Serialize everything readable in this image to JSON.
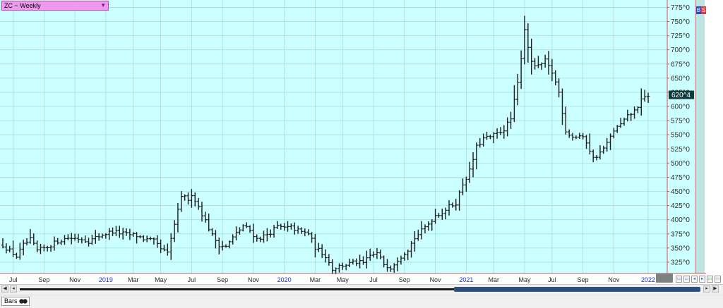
{
  "header": {
    "symbol_label": "ZC ~ Weekly",
    "dropdown_arrow": "▼",
    "side_buttons": [
      "B",
      "S"
    ]
  },
  "bottom_tabs": {
    "bars_label": "Bars",
    "bars_icon": "toggle-icon"
  },
  "scrollbar": {
    "left_btn": "◀",
    "left_btn2": "◂",
    "right_btn": "▸",
    "right_btn2": "▶"
  },
  "colors": {
    "plot_bg": "#ccffff",
    "grid": "#a3dede",
    "bars": "#1a1a1a",
    "axis_border": "#e05050",
    "year_label": "#1530c8",
    "month_label": "#2a2a2a",
    "price_label": "#333333",
    "last_price_bg": "#0e3a3a"
  },
  "chart_data": {
    "type": "ohlc",
    "title": "ZC ~ Weekly",
    "y_axis": {
      "range": [
        305,
        788
      ],
      "ticks": [
        {
          "value": 325,
          "label": "325^0"
        },
        {
          "value": 350,
          "label": "350^0"
        },
        {
          "value": 375,
          "label": "375^0"
        },
        {
          "value": 400,
          "label": "400^0"
        },
        {
          "value": 425,
          "label": "425^0"
        },
        {
          "value": 450,
          "label": "450^0"
        },
        {
          "value": 475,
          "label": "475^0"
        },
        {
          "value": 500,
          "label": "500^0"
        },
        {
          "value": 525,
          "label": "525^0"
        },
        {
          "value": 550,
          "label": "550^0"
        },
        {
          "value": 575,
          "label": "575^0"
        },
        {
          "value": 600,
          "label": "600^0"
        },
        {
          "value": 625,
          "label": "625^0"
        },
        {
          "value": 650,
          "label": "650^0"
        },
        {
          "value": 675,
          "label": "675^0"
        },
        {
          "value": 700,
          "label": "700^0"
        },
        {
          "value": 725,
          "label": "725^0"
        },
        {
          "value": 750,
          "label": "750^0"
        },
        {
          "value": 775,
          "label": "775^0"
        }
      ],
      "last_price": {
        "value": 620.5,
        "label": "620^4"
      }
    },
    "x_axis": {
      "range_weeks": [
        0,
        188
      ],
      "ticks": [
        {
          "label": "Jul",
          "week": 3,
          "year": false
        },
        {
          "label": "Sep",
          "week": 12,
          "year": false
        },
        {
          "label": "Nov",
          "week": 21,
          "year": false
        },
        {
          "label": "2019",
          "week": 30,
          "year": true
        },
        {
          "label": "Mar",
          "week": 38,
          "year": false
        },
        {
          "label": "May",
          "week": 46,
          "year": false
        },
        {
          "label": "Jul",
          "week": 55,
          "year": false
        },
        {
          "label": "Sep",
          "week": 64,
          "year": false
        },
        {
          "label": "Nov",
          "week": 73,
          "year": false
        },
        {
          "label": "2020",
          "week": 82,
          "year": true
        },
        {
          "label": "Mar",
          "week": 91,
          "year": false
        },
        {
          "label": "May",
          "week": 99,
          "year": false
        },
        {
          "label": "Jul",
          "week": 108,
          "year": false
        },
        {
          "label": "Sep",
          "week": 117,
          "year": false
        },
        {
          "label": "Nov",
          "week": 126,
          "year": false
        },
        {
          "label": "2021",
          "week": 135,
          "year": true
        },
        {
          "label": "Mar",
          "week": 143,
          "year": false
        },
        {
          "label": "May",
          "week": 152,
          "year": false
        },
        {
          "label": "Jul",
          "week": 160,
          "year": false
        },
        {
          "label": "Sep",
          "week": 169,
          "year": false
        },
        {
          "label": "Nov",
          "week": 178,
          "year": false
        },
        {
          "label": "2022",
          "week": 188,
          "year": true
        }
      ]
    },
    "anchors": [
      [
        0,
        355
      ],
      [
        4,
        335
      ],
      [
        6,
        355
      ],
      [
        8,
        365
      ],
      [
        10,
        345
      ],
      [
        13,
        352
      ],
      [
        16,
        362
      ],
      [
        19,
        368
      ],
      [
        23,
        366
      ],
      [
        25,
        362
      ],
      [
        29,
        374
      ],
      [
        32,
        379
      ],
      [
        36,
        374
      ],
      [
        39,
        372
      ],
      [
        41,
        366
      ],
      [
        44,
        362
      ],
      [
        46,
        348
      ],
      [
        48,
        340
      ],
      [
        50,
        392
      ],
      [
        52,
        438
      ],
      [
        53,
        444
      ],
      [
        54,
        431
      ],
      [
        55,
        446
      ],
      [
        57,
        423
      ],
      [
        59,
        398
      ],
      [
        61,
        372
      ],
      [
        63,
        356
      ],
      [
        65,
        352
      ],
      [
        68,
        376
      ],
      [
        70,
        389
      ],
      [
        72,
        381
      ],
      [
        74,
        366
      ],
      [
        76,
        371
      ],
      [
        78,
        378
      ],
      [
        80,
        388
      ],
      [
        82,
        385
      ],
      [
        84,
        386
      ],
      [
        87,
        378
      ],
      [
        89,
        376
      ],
      [
        91,
        351
      ],
      [
        94,
        336
      ],
      [
        96,
        313
      ],
      [
        98,
        318
      ],
      [
        100,
        321
      ],
      [
        103,
        325
      ],
      [
        105,
        323
      ],
      [
        107,
        336
      ],
      [
        109,
        340
      ],
      [
        111,
        322
      ],
      [
        113,
        316
      ],
      [
        115,
        330
      ],
      [
        118,
        348
      ],
      [
        120,
        368
      ],
      [
        122,
        380
      ],
      [
        124,
        393
      ],
      [
        126,
        408
      ],
      [
        128,
        413
      ],
      [
        130,
        423
      ],
      [
        132,
        430
      ],
      [
        134,
        463
      ],
      [
        136,
        486
      ],
      [
        138,
        528
      ],
      [
        140,
        543
      ],
      [
        142,
        546
      ],
      [
        144,
        552
      ],
      [
        146,
        560
      ],
      [
        148,
        578
      ],
      [
        150,
        640
      ],
      [
        152,
        737
      ],
      [
        154,
        676
      ],
      [
        156,
        670
      ],
      [
        158,
        680
      ],
      [
        160,
        660
      ],
      [
        162,
        625
      ],
      [
        164,
        557
      ],
      [
        166,
        546
      ],
      [
        168,
        548
      ],
      [
        170,
        538
      ],
      [
        172,
        508
      ],
      [
        174,
        518
      ],
      [
        176,
        534
      ],
      [
        178,
        558
      ],
      [
        180,
        568
      ],
      [
        182,
        582
      ],
      [
        184,
        592
      ],
      [
        186,
        610
      ],
      [
        188,
        620
      ]
    ]
  }
}
